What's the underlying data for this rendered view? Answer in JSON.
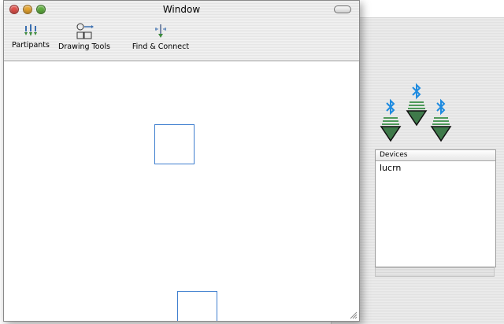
{
  "window": {
    "title": "Window"
  },
  "toolbar": {
    "items": [
      {
        "label": "Partipants",
        "icon": "participants-icon"
      },
      {
        "label": "Drawing Tools",
        "icon": "drawing-tools-icon"
      },
      {
        "label": "Find & Connect",
        "icon": "find-connect-icon"
      }
    ]
  },
  "devices": {
    "header": "Devices",
    "items": [
      "lucrn"
    ]
  },
  "colors": {
    "bluetooth": "#1e8be0",
    "shape_stroke": "#3f7fcf",
    "cone": "#3f7a4a"
  }
}
